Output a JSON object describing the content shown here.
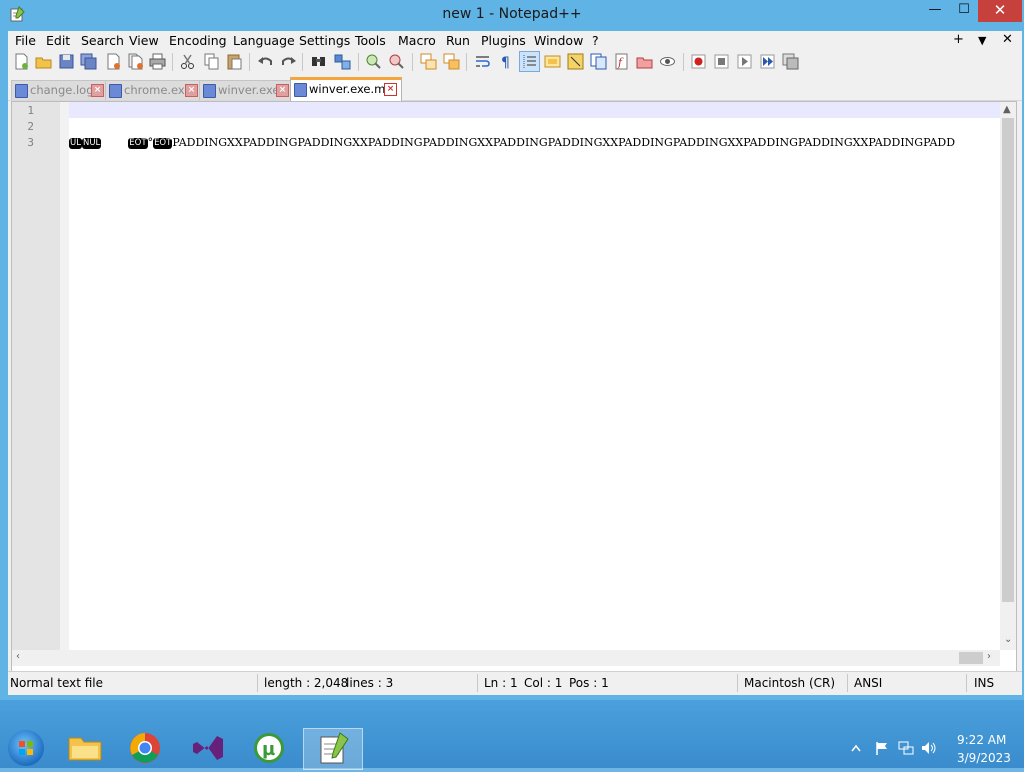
{
  "window": {
    "title": "new 1 - Notepad++",
    "buttons": {
      "minimize": "—",
      "maximize": "☐",
      "close": "✕"
    }
  },
  "menubar": {
    "items": [
      "File",
      "Edit",
      "Search",
      "View",
      "Encoding",
      "Language",
      "Settings",
      "Tools",
      "Macro",
      "Run",
      "Plugins",
      "Window",
      "?"
    ],
    "right": {
      "add": "+",
      "dropdown": "▼",
      "close": "✕"
    }
  },
  "toolbar": {
    "icons": [
      "new-file-icon",
      "open-file-icon",
      "save-icon",
      "save-all-icon",
      "close-icon",
      "close-all-icon",
      "print-icon",
      "cut-icon",
      "copy-icon",
      "paste-icon",
      "undo-icon",
      "redo-icon",
      "find-icon",
      "replace-icon",
      "zoom-in-icon",
      "zoom-out-icon",
      "sync-vertical-icon",
      "sync-horizontal-icon",
      "word-wrap-icon",
      "show-all-chars-icon",
      "indent-guide-icon",
      "lang-icon",
      "doc-map-icon",
      "function-list-icon",
      "folder-as-workspace-icon",
      "monitoring-icon",
      "record-macro-icon",
      "stop-macro-icon",
      "play-macro-icon",
      "run-macro-multiple-icon",
      "save-macro-icon"
    ]
  },
  "tabs": [
    {
      "label": "change.log",
      "active": false
    },
    {
      "label": "chrome.exe",
      "active": false
    },
    {
      "label": "winver.exe",
      "active": false
    },
    {
      "label": "winver.exe.mui",
      "active": true
    }
  ],
  "editor": {
    "line_numbers": [
      "1",
      "2",
      "3"
    ],
    "line3": {
      "ctl1": "UL",
      "ctl2": "NUL",
      "ctl3": "EOT",
      "degree": "°",
      "ctl4": "EOT",
      "text": "PADDINGXXPADDINGPADDINGXXPADDINGPADDINGXXPADDINGPADDINGXXPADDINGPADDINGXXPADDINGPADDINGXXPADDINGPADD"
    }
  },
  "statusbar": {
    "type": "Normal text file",
    "length": "length : 2,048",
    "lines": "lines : 3",
    "ln": "Ln : 1",
    "col": "Col : 1",
    "pos": "Pos : 1",
    "eol": "Macintosh (CR)",
    "encoding": "ANSI",
    "mode": "INS"
  },
  "taskbar": {
    "apps": [
      "file-explorer-icon",
      "chrome-icon",
      "visual-studio-icon",
      "utorrent-icon",
      "notepad-plus-plus-icon"
    ],
    "time": "9:22 AM",
    "date": "3/9/2023"
  }
}
